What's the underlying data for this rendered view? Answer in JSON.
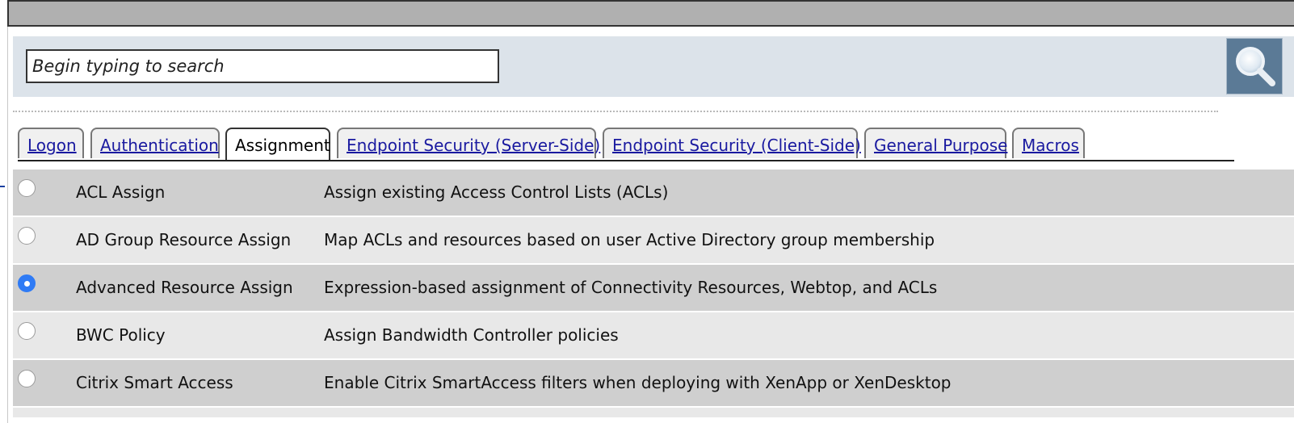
{
  "search": {
    "placeholder": "Begin typing to search",
    "button_icon": "magnifier-icon"
  },
  "tabs": [
    {
      "label": "Logon",
      "active": false
    },
    {
      "label": "Authentication",
      "active": false
    },
    {
      "label": "Assignment",
      "active": true
    },
    {
      "label": "Endpoint Security (Server-Side)",
      "active": false
    },
    {
      "label": "Endpoint Security (Client-Side)",
      "active": false
    },
    {
      "label": "General Purpose",
      "active": false
    },
    {
      "label": "Macros",
      "active": false
    }
  ],
  "items": [
    {
      "name": "ACL Assign",
      "description": "Assign existing Access Control Lists (ACLs)",
      "selected": false
    },
    {
      "name": "AD Group Resource Assign",
      "description": "Map ACLs and resources based on user Active Directory group membership",
      "selected": false
    },
    {
      "name": "Advanced Resource Assign",
      "description": "Expression-based assignment of Connectivity Resources, Webtop, and ACLs",
      "selected": true
    },
    {
      "name": "BWC Policy",
      "description": "Assign Bandwidth Controller policies",
      "selected": false
    },
    {
      "name": "Citrix Smart Access",
      "description": "Enable Citrix SmartAccess filters when deploying with XenApp or XenDesktop",
      "selected": false
    }
  ],
  "colors": {
    "selected_radio": "#2f7bf5",
    "search_button": "#5b7a96",
    "search_panel": "#dce3ea",
    "link": "#1a1aa0"
  }
}
